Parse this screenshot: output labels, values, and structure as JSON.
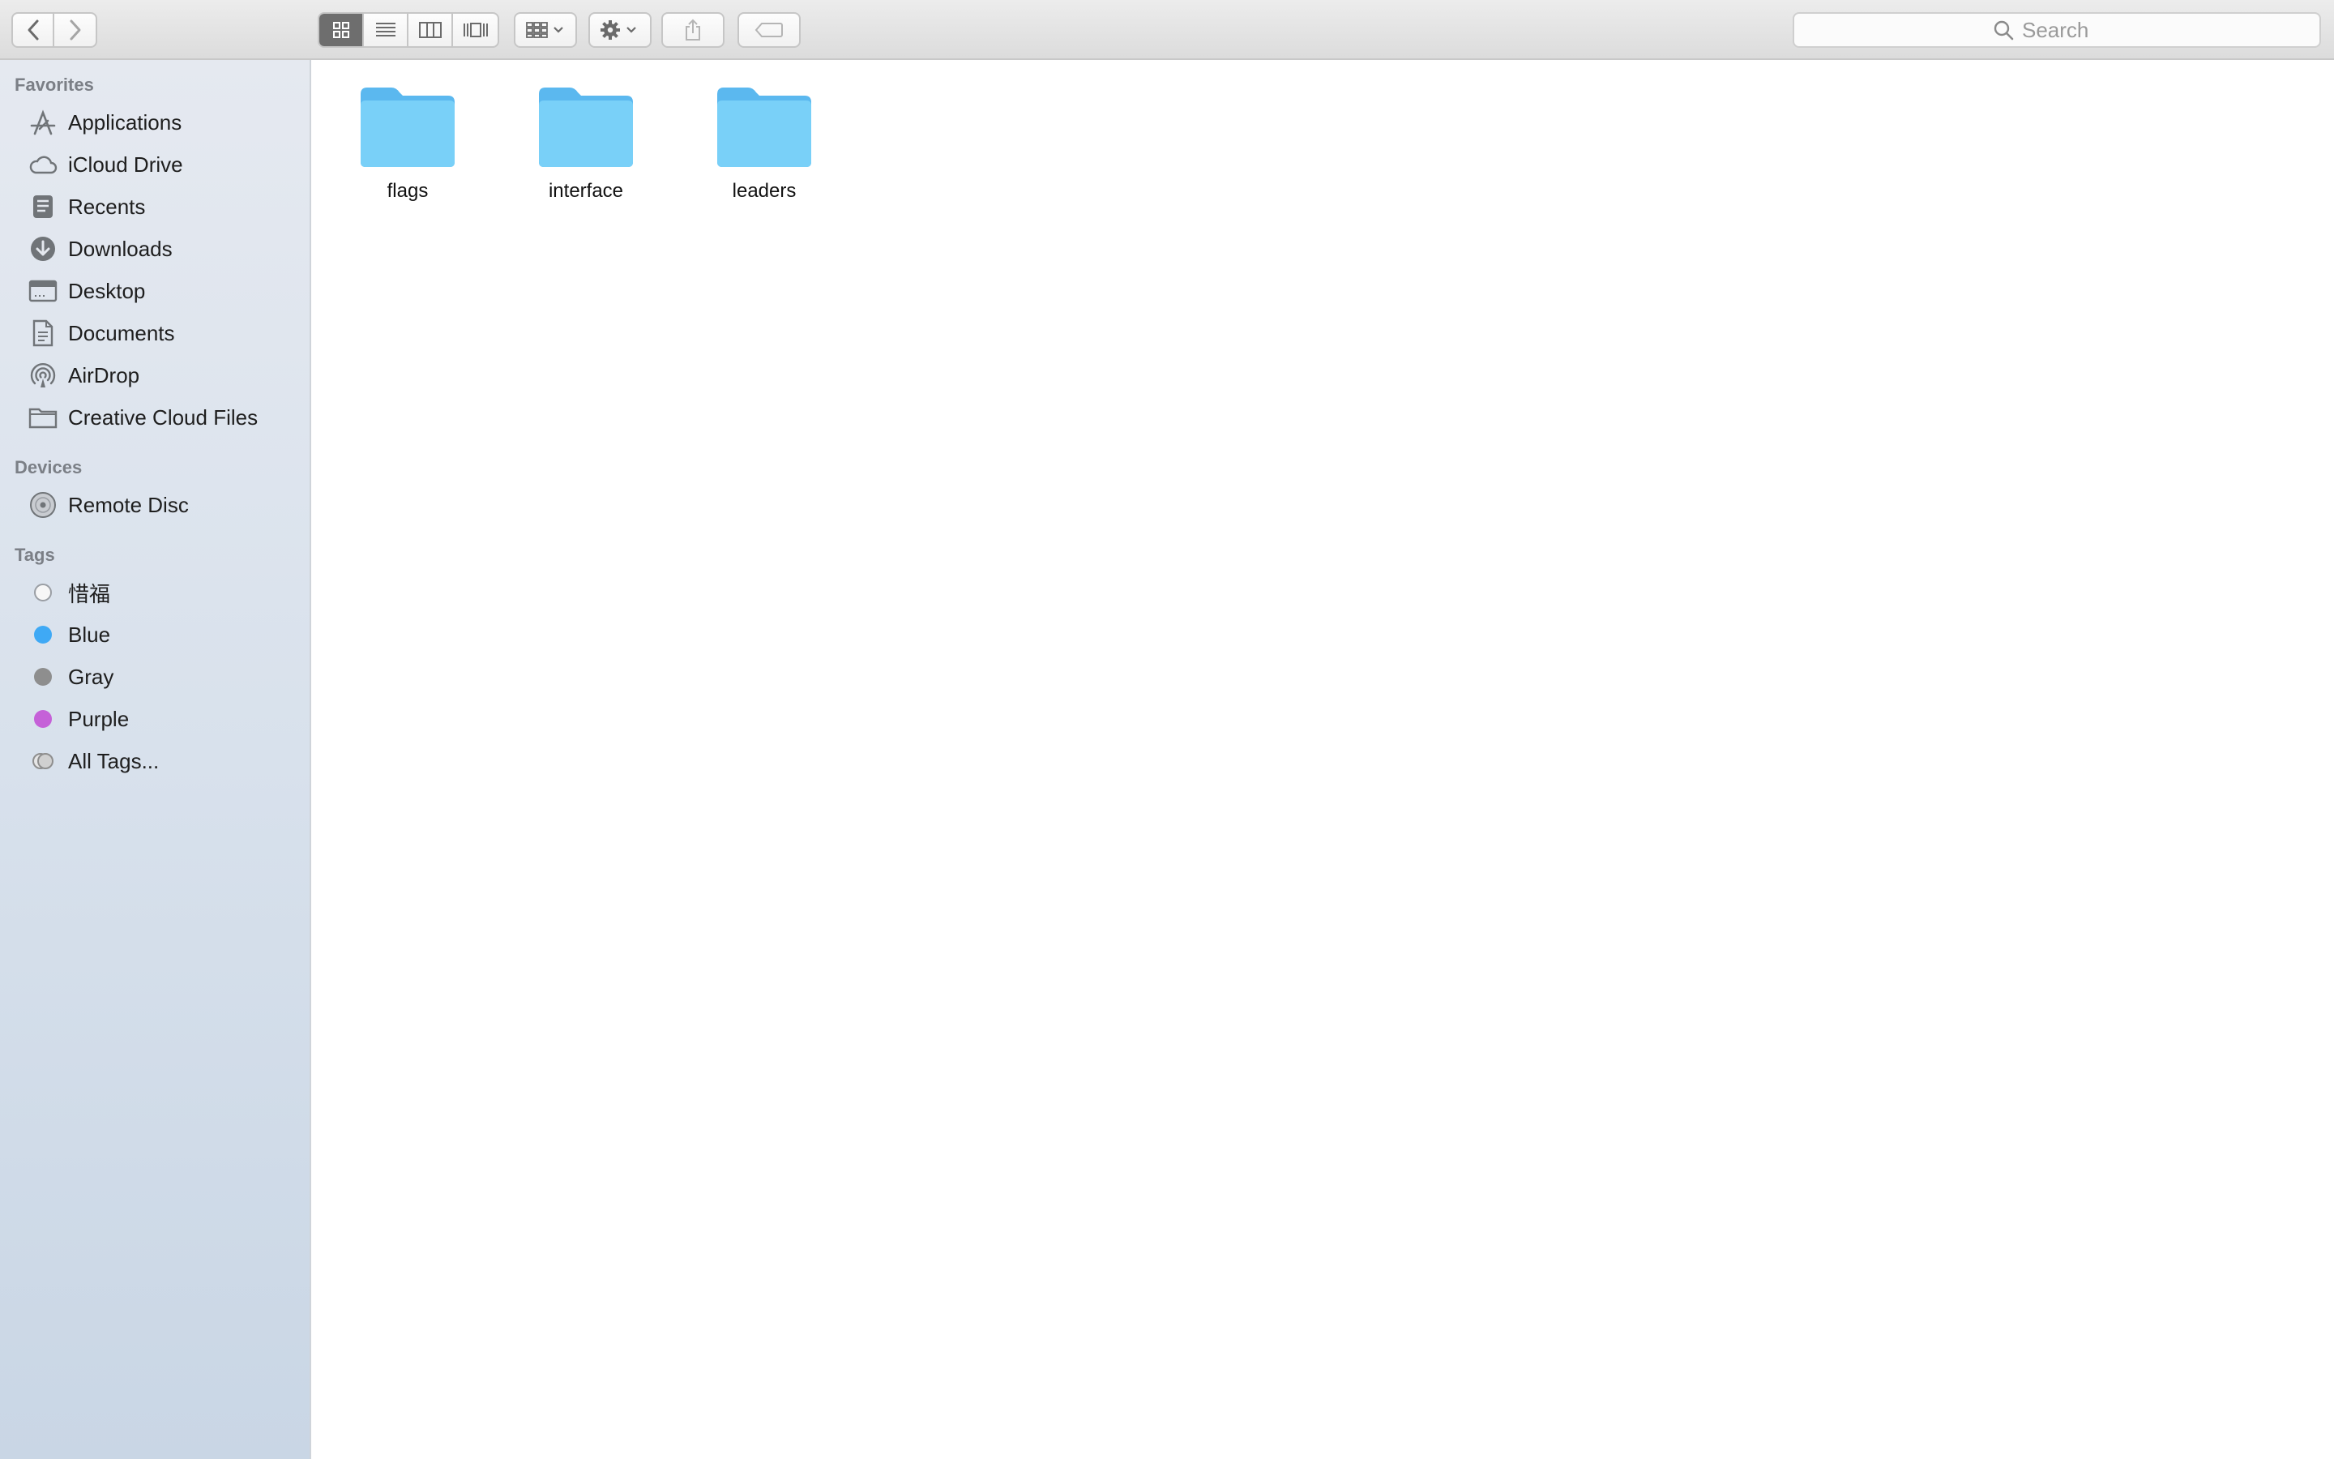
{
  "toolbar": {
    "back_label": "‹",
    "forward_label": "›",
    "search_placeholder": "Search"
  },
  "sidebar": {
    "favorites_title": "Favorites",
    "favorites": [
      {
        "label": "Applications",
        "icon": "applications-icon"
      },
      {
        "label": "iCloud Drive",
        "icon": "cloud-icon"
      },
      {
        "label": "Recents",
        "icon": "recents-icon"
      },
      {
        "label": "Downloads",
        "icon": "download-icon"
      },
      {
        "label": "Desktop",
        "icon": "desktop-icon"
      },
      {
        "label": "Documents",
        "icon": "documents-icon"
      },
      {
        "label": "AirDrop",
        "icon": "airdrop-icon"
      },
      {
        "label": "Creative Cloud Files",
        "icon": "folder-icon"
      }
    ],
    "devices_title": "Devices",
    "devices": [
      {
        "label": "Remote Disc",
        "icon": "disc-icon"
      }
    ],
    "tags_title": "Tags",
    "tags": [
      {
        "label": "惜福",
        "color": "#ffffff"
      },
      {
        "label": "Blue",
        "color": "#3fa9f5"
      },
      {
        "label": "Gray",
        "color": "#8e8e8e"
      },
      {
        "label": "Purple",
        "color": "#c561d8"
      },
      {
        "label": "All Tags...",
        "color": "#d0d0d0"
      }
    ]
  },
  "main": {
    "folders": [
      {
        "name": "flags"
      },
      {
        "name": "interface"
      },
      {
        "name": "leaders"
      }
    ],
    "folder_color": "#6cc6f5"
  }
}
